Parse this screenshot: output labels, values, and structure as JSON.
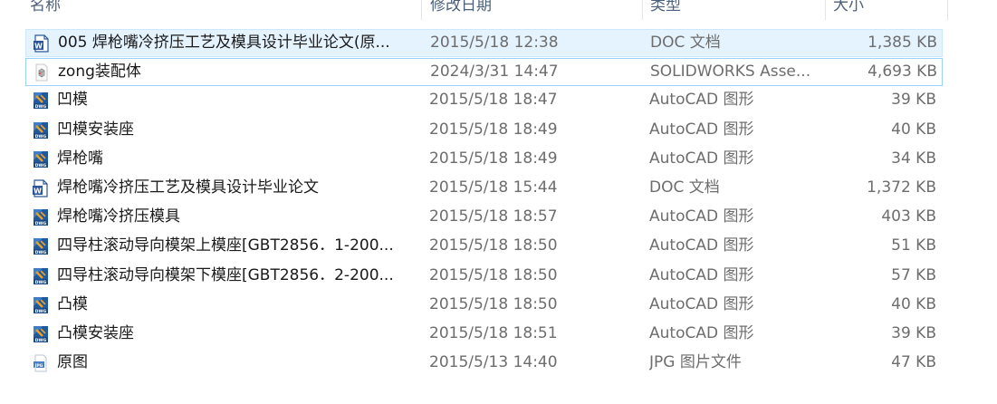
{
  "columns": {
    "name": "名称",
    "date": "修改日期",
    "type": "类型",
    "size": "大小"
  },
  "files": [
    {
      "name": "005 焊枪嘴冷挤压工艺及模具设计毕业论文(原...",
      "date": "2015/5/18 12:38",
      "type": "DOC 文档",
      "size": "1,385 KB",
      "icon": "word-doc-icon",
      "state": "selected"
    },
    {
      "name": "zong装配体",
      "date": "2024/3/31 14:47",
      "type": "SOLIDWORKS Asse...",
      "size": "4,693 KB",
      "icon": "solidworks-assembly-icon",
      "state": "focused"
    },
    {
      "name": "凹模",
      "date": "2015/5/18 18:47",
      "type": "AutoCAD 图形",
      "size": "39 KB",
      "icon": "dwg-file-icon",
      "state": ""
    },
    {
      "name": "凹模安装座",
      "date": "2015/5/18 18:49",
      "type": "AutoCAD 图形",
      "size": "40 KB",
      "icon": "dwg-file-icon",
      "state": ""
    },
    {
      "name": "焊枪嘴",
      "date": "2015/5/18 18:49",
      "type": "AutoCAD 图形",
      "size": "34 KB",
      "icon": "dwg-file-icon",
      "state": ""
    },
    {
      "name": "焊枪嘴冷挤压工艺及模具设计毕业论文",
      "date": "2015/5/18 15:44",
      "type": "DOC 文档",
      "size": "1,372 KB",
      "icon": "word-doc-icon",
      "state": ""
    },
    {
      "name": "焊枪嘴冷挤压模具",
      "date": "2015/5/18 18:57",
      "type": "AutoCAD 图形",
      "size": "403 KB",
      "icon": "dwg-file-icon",
      "state": ""
    },
    {
      "name": "四导柱滚动导向模架上模座[GBT2856．1-200...",
      "date": "2015/5/18 18:50",
      "type": "AutoCAD 图形",
      "size": "51 KB",
      "icon": "dwg-file-icon",
      "state": ""
    },
    {
      "name": "四导柱滚动导向模架下模座[GBT2856．2-200...",
      "date": "2015/5/18 18:50",
      "type": "AutoCAD 图形",
      "size": "57 KB",
      "icon": "dwg-file-icon",
      "state": ""
    },
    {
      "name": "凸模",
      "date": "2015/5/18 18:50",
      "type": "AutoCAD 图形",
      "size": "40 KB",
      "icon": "dwg-file-icon",
      "state": ""
    },
    {
      "name": "凸模安装座",
      "date": "2015/5/18 18:51",
      "type": "AutoCAD 图形",
      "size": "39 KB",
      "icon": "dwg-file-icon",
      "state": ""
    },
    {
      "name": "原图",
      "date": "2015/5/13 14:40",
      "type": "JPG 图片文件",
      "size": "47 KB",
      "icon": "jpg-image-icon",
      "state": ""
    }
  ],
  "colors": {
    "selected_bg": "#e5f3ff",
    "selected_border": "#cce8ff",
    "focus_border": "#99d1ff",
    "word_blue": "#2b579a",
    "dwg_blue": "#1f5aa0",
    "dwg_orange": "#f0a01e"
  }
}
